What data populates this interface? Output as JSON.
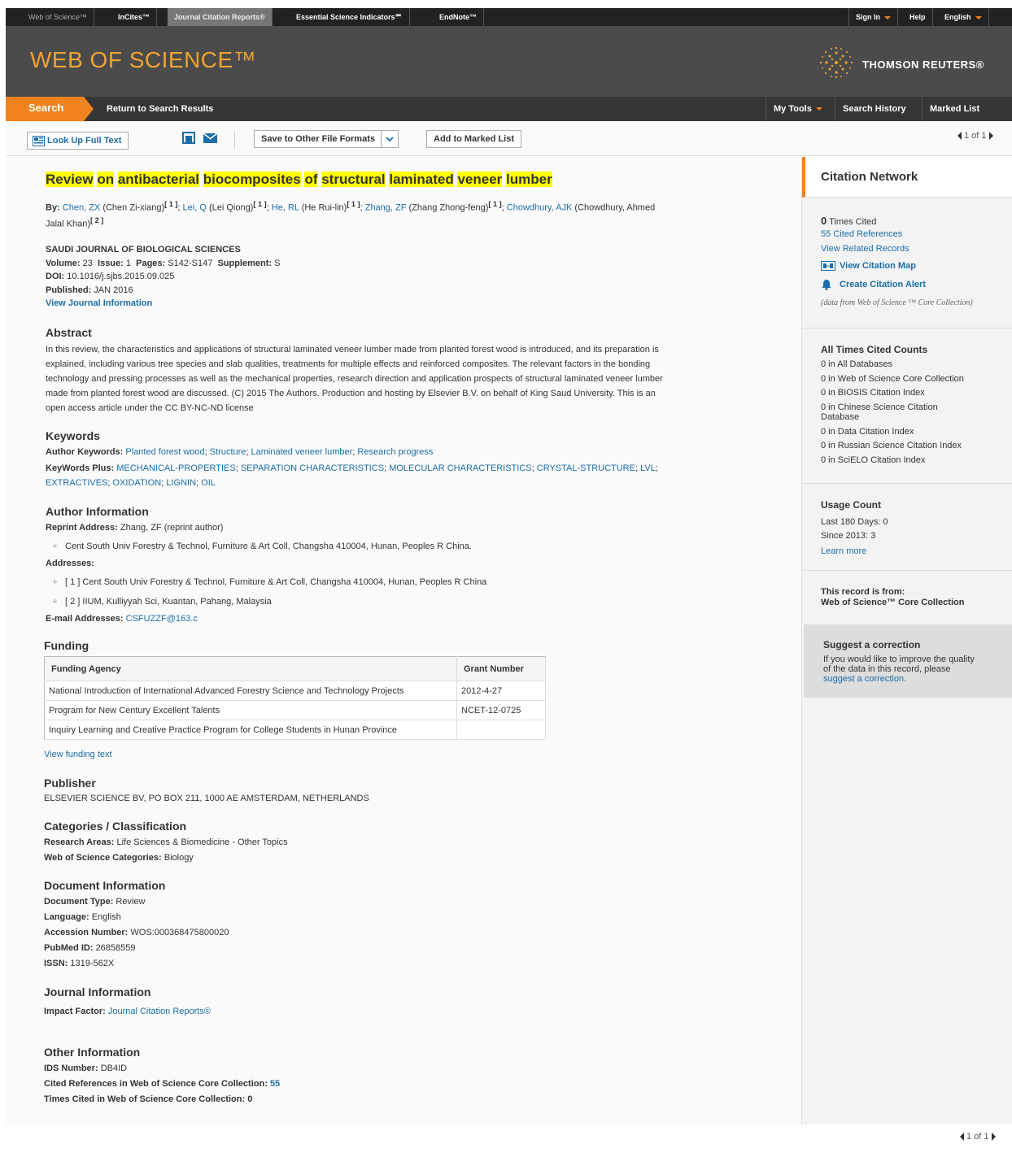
{
  "topbar": {
    "products": [
      "Web of Science™",
      "InCites™",
      "Journal Citation Reports®",
      "Essential Science Indicators℠",
      "EndNote™"
    ],
    "sign_in": "Sign In",
    "help": "Help",
    "language": "English"
  },
  "header": {
    "logo": "WEB OF SCIENCE™",
    "brand": "THOMSON REUTERS®"
  },
  "nav": {
    "search": "Search",
    "return": "Return to Search Results",
    "my_tools": "My Tools",
    "search_history": "Search History",
    "marked_list": "Marked List"
  },
  "toolbar": {
    "look_up": "Look Up Full Text",
    "save": "Save to Other File Formats",
    "add_marked": "Add to Marked List",
    "pager": "1 of 1"
  },
  "record": {
    "title_words": [
      "Review",
      "on",
      "antibacterial",
      "biocomposites",
      "of",
      "structural",
      "laminated",
      "veneer",
      "lumber"
    ],
    "by_label": "By:",
    "authors": [
      {
        "short": "Chen, ZX",
        "full": "(Chen Zi-xiang)",
        "ref": "[ 1 ]"
      },
      {
        "short": "Lei, Q",
        "full": "(Lei Qiong)",
        "ref": "[ 1 ]"
      },
      {
        "short": "He, RL",
        "full": "(He Rui-lin)",
        "ref": "[ 1 ]"
      },
      {
        "short": "Zhang, ZF",
        "full": "(Zhang Zhong-feng)",
        "ref": "[ 1 ]"
      },
      {
        "short": "Chowdhury, AJK",
        "full": "(Chowdhury, Ahmed",
        "ref": ""
      }
    ],
    "author_tail": "Jalal Khan)",
    "author_tail_ref": "[ 2 ]",
    "journal": "SAUDI JOURNAL OF BIOLOGICAL SCIENCES",
    "volume_label": "Volume:",
    "volume": "23",
    "issue_label": "Issue:",
    "issue": "1",
    "pages_label": "Pages:",
    "pages": "S142-S147",
    "supplement_label": "Supplement:",
    "supplement": "S",
    "doi_label": "DOI:",
    "doi": "10.1016/j.sjbs.2015.09.025",
    "published_label": "Published:",
    "published": "JAN 2016",
    "view_journal": "View Journal Information"
  },
  "abstract": {
    "heading": "Abstract",
    "lines": [
      "In this review, the characteristics and applications of structural laminated veneer lumber made from planted forest wood is introduced, and its preparation is",
      "explained, including various tree species and slab qualities, treatments for multiple effects and reinforced composites. The relevant factors in the bonding",
      "technology and pressing processes as well as the mechanical properties, research direction and application prospects of structural laminated veneer lumber",
      "made from planted forest wood are discussed. (C) 2015 The Authors. Production and hosting by Elsevier B.V. on behalf of King Saud University. This is an",
      "open access article under the CC BY-NC-ND license"
    ]
  },
  "keywords": {
    "heading": "Keywords",
    "author_label": "Author Keywords:",
    "author": [
      "Planted forest wood",
      "Structure",
      "Laminated veneer lumber",
      "Research progress"
    ],
    "plus_label": "KeyWords Plus:",
    "plus_line1": [
      "MECHANICAL-PROPERTIES",
      "SEPARATION CHARACTERISTICS",
      "MOLECULAR CHARACTERISTICS",
      "CRYSTAL-STRUCTURE",
      "LVL"
    ],
    "plus_line2": [
      "EXTRACTIVES",
      "OXIDATION",
      "LIGNIN",
      "OIL"
    ]
  },
  "author_info": {
    "heading": "Author Information",
    "reprint_label": "Reprint Address:",
    "reprint": "Zhang, ZF (reprint author)",
    "reprint_addr": "Cent South Univ Forestry & Technol, Furniture & Art Coll, Changsha 410004, Hunan, Peoples R China.",
    "addresses_label": "Addresses:",
    "addresses": [
      "[ 1 ] Cent South Univ Forestry & Technol, Furniture & Art Coll, Changsha 410004, Hunan, Peoples R China",
      "[ 2 ] IIUM, Kulliyyah Sci, Kuantan, Pahang, Malaysia"
    ],
    "email_label": "E-mail Addresses:",
    "email": "CSFUZZF@163.c"
  },
  "funding": {
    "heading": "Funding",
    "col_agency": "Funding Agency",
    "col_grant": "Grant Number",
    "rows": [
      {
        "agency": "National Introduction of International Advanced Forestry Science and Technology Projects",
        "grant": "2012-4-27"
      },
      {
        "agency": "Program for New Century Excellent Talents",
        "grant": "NCET-12-0725"
      },
      {
        "agency": "Inquiry Learning and Creative Practice Program for College Students in Hunan Province",
        "grant": ""
      }
    ],
    "view_text": "View funding text"
  },
  "publisher": {
    "heading": "Publisher",
    "value": "ELSEVIER SCIENCE BV, PO BOX 211, 1000 AE AMSTERDAM, NETHERLANDS"
  },
  "categories": {
    "heading": "Categories / Classification",
    "research_label": "Research Areas:",
    "research": "Life Sciences & Biomedicine - Other Topics",
    "wos_label": "Web of Science Categories:",
    "wos": "Biology"
  },
  "document": {
    "heading": "Document Information",
    "type_label": "Document Type:",
    "type": "Review",
    "lang_label": "Language:",
    "lang": "English",
    "acc_label": "Accession Number:",
    "acc": "WOS:000368475800020",
    "pubmed_label": "PubMed ID:",
    "pubmed": "26858559",
    "issn_label": "ISSN:",
    "issn": "1319-562X"
  },
  "journal_info": {
    "heading": "Journal Information",
    "if_label": "Impact Factor:",
    "if_link": "Journal Citation Reports®"
  },
  "other": {
    "heading": "Other Information",
    "ids_label": "IDS Number:",
    "ids": "DB4ID",
    "cited_label": "Cited References in Web of Science Core Collection:",
    "cited": "55",
    "times_label": "Times Cited in Web of Science Core Collection:",
    "times": "0"
  },
  "sidebar": {
    "heading": "Citation Network",
    "times_cited_num": "0",
    "times_cited": "Times Cited",
    "cited_refs": "55 Cited References",
    "related": "View Related Records",
    "citation_map": "View Citation Map",
    "alert": "Create Citation Alert",
    "data_from": "(data from Web of Science ™ Core Collection)",
    "counts_heading": "All Times Cited Counts",
    "counts": [
      "0 in All Databases",
      "0 in Web of Science Core Collection",
      "0 in BIOSIS Citation Index",
      "0 in Chinese Science Citation",
      "Database",
      "0 in Data Citation Index",
      "0 in Russian Science Citation Index",
      "0 in SciELO Citation Index"
    ],
    "usage_heading": "Usage Count",
    "last180": "Last 180 Days: 0",
    "since2013": "Since 2013: 3",
    "learn_more": "Learn more",
    "record_from_label": "This record is from:",
    "record_from": "Web of Science™ Core Collection",
    "suggest_heading": "Suggest a correction",
    "suggest_lines": [
      "If you would like to improve the quality",
      "of the data in this record, please"
    ],
    "suggest_link": "suggest a correction."
  },
  "colors": {
    "accent": "#f0831f",
    "link": "#1b6ea8",
    "header": "#4b4b4b",
    "highlight": "#ffff00"
  }
}
